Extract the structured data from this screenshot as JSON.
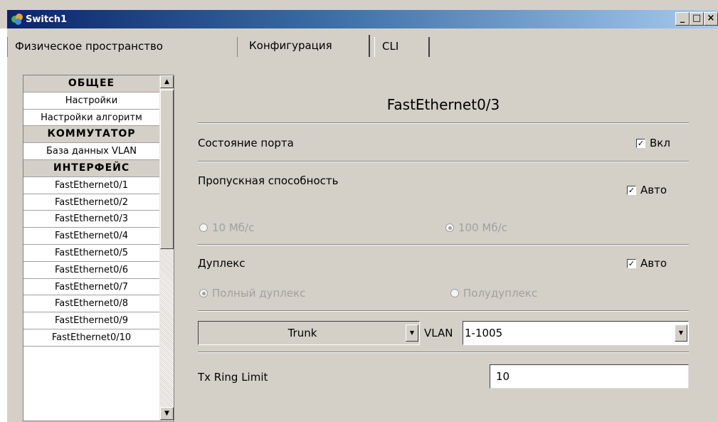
{
  "window": {
    "title": "Switch1",
    "minimize": "_",
    "maximize": "□",
    "close": "×"
  },
  "tabs": [
    {
      "label": "Физическое пространство"
    },
    {
      "label": "Конфигурация"
    },
    {
      "label": "CLI"
    }
  ],
  "sidebar": {
    "items": [
      {
        "label": "ОБЩЕЕ",
        "type": "header"
      },
      {
        "label": "Настройки",
        "type": "item"
      },
      {
        "label": "Настройки алгоритм",
        "type": "item"
      },
      {
        "label": "КОММУТАТОР",
        "type": "header"
      },
      {
        "label": "База данных VLAN",
        "type": "item"
      },
      {
        "label": "ИНТЕРФЕЙС",
        "type": "header"
      },
      {
        "label": "FastEthernet0/1",
        "type": "item"
      },
      {
        "label": "FastEthernet0/2",
        "type": "item"
      },
      {
        "label": "FastEthernet0/3",
        "type": "item"
      },
      {
        "label": "FastEthernet0/4",
        "type": "item"
      },
      {
        "label": "FastEthernet0/5",
        "type": "item"
      },
      {
        "label": "FastEthernet0/6",
        "type": "item"
      },
      {
        "label": "FastEthernet0/7",
        "type": "item"
      },
      {
        "label": "FastEthernet0/8",
        "type": "item"
      },
      {
        "label": "FastEthernet0/9",
        "type": "item"
      },
      {
        "label": "FastEthernet0/10",
        "type": "item"
      }
    ]
  },
  "config": {
    "port_title": "FastEthernet0/3",
    "port_status": {
      "label": "Состояние порта",
      "checkbox_label": "Вкл",
      "checked": true
    },
    "bandwidth": {
      "label": "Пропускная способность",
      "checkbox_label": "Авто",
      "checked": true,
      "option_10": "10 Мб/с",
      "option_100": "100 Мб/с",
      "selected": "100 Мб/с"
    },
    "duplex": {
      "label": "Дуплекс",
      "checkbox_label": "Авто",
      "checked": true,
      "option_full": "Полный дуплекс",
      "option_half": "Полудуплекс",
      "selected": "Полный дуплекс"
    },
    "mode_select": "Trunk",
    "vlan_label": "VLAN",
    "vlan_select": "1-1005",
    "tx_ring": {
      "label": "Tx Ring Limit",
      "value": "10"
    }
  }
}
